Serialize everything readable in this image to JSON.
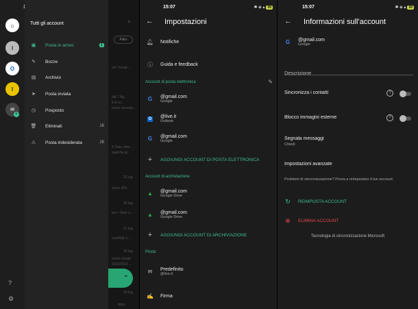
{
  "status": {
    "time": "15:07",
    "battery": "99"
  },
  "panel1": {
    "drawer_title": "Tutti gli account",
    "rail": [
      {
        "letter": "",
        "icon": "home-icon"
      },
      {
        "letter": "I",
        "icon": "avatar-i"
      },
      {
        "letter": "O",
        "icon": "outlook-icon"
      },
      {
        "letter": "I",
        "icon": "avatar-i-yellow"
      },
      {
        "letter": "",
        "icon": "mail-icon"
      }
    ],
    "items": [
      {
        "label": "Posta in arrivo",
        "count": "1",
        "icon": "inbox-icon"
      },
      {
        "label": "Bozze",
        "count": "",
        "icon": "draft-icon"
      },
      {
        "label": "Archivio",
        "count": "",
        "icon": "archive-icon"
      },
      {
        "label": "Posta inviata",
        "count": "",
        "icon": "send-icon"
      },
      {
        "label": "Posposto",
        "count": "",
        "icon": "clock-icon"
      },
      {
        "label": "Eliminati",
        "count": "16",
        "icon": "trash-icon"
      },
      {
        "label": "Posta indesiderata",
        "count": "26",
        "icon": "spam-icon"
      }
    ],
    "filter_label": "Filtro",
    "bg_snippets": [
      "set' Visual...",
      "dal 7 Ag...",
      "ti le ru...",
      "enuto ricevuto...",
      "ll Olap • Are...",
      "qualche gi...",
      "23 lug",
      "zione 350...",
      "25 lug",
      "per • View s...",
      "21 lug",
      "cessfully n...",
      "18 lug",
      "rendo Grado",
      "2022/2023 ...",
      "18 lug",
      "Altro"
    ]
  },
  "panel2": {
    "title": "Impostazioni",
    "notifications": "Notifiche",
    "help": "Guida e feedback",
    "email_section": "Account di posta elettronica",
    "email_accounts": [
      {
        "email": "@gmail.com",
        "provider": "Google"
      },
      {
        "email": "@live.it",
        "provider": "Outlook"
      },
      {
        "email": "@gmail.com",
        "provider": "Google"
      }
    ],
    "add_email": "AGGIUNGI ACCOUNT DI POSTA ELETTRONICA",
    "storage_section": "Account di archiviazione",
    "storage_accounts": [
      {
        "email": "@gmail.com",
        "provider": "Google Drive"
      },
      {
        "email": "@gmail.com",
        "provider": "Google Drive"
      }
    ],
    "add_storage": "AGGIUNGI ACCOUNT DI ARCHIVIAZIONE",
    "mail_section": "Posta",
    "default_label": "Predefinito",
    "default_value": "@live.it",
    "signature": "Firma"
  },
  "panel3": {
    "title": "Informazioni sull'account",
    "account_email": "@gmail.com",
    "account_provider": "Google",
    "description_placeholder": "Descrizione",
    "sync_contacts": "Sincronizza i contatti",
    "block_images": "Blocco immagini esterne",
    "mark_messages": "Segnala messaggi",
    "mark_value": "Chiedi",
    "advanced": "Impostazioni avanzate",
    "sync_problem": "Problemi di sincronizzazione? Prova a reimpostare il tuo account.",
    "reset": "REIMPOSTA ACCOUNT",
    "delete": "ELIMINA ACCOUNT",
    "tech": "Tecnologia di sincronizzazione Microsoft"
  },
  "colors": {
    "accent": "#3fbf8f",
    "danger": "#e5484d"
  }
}
